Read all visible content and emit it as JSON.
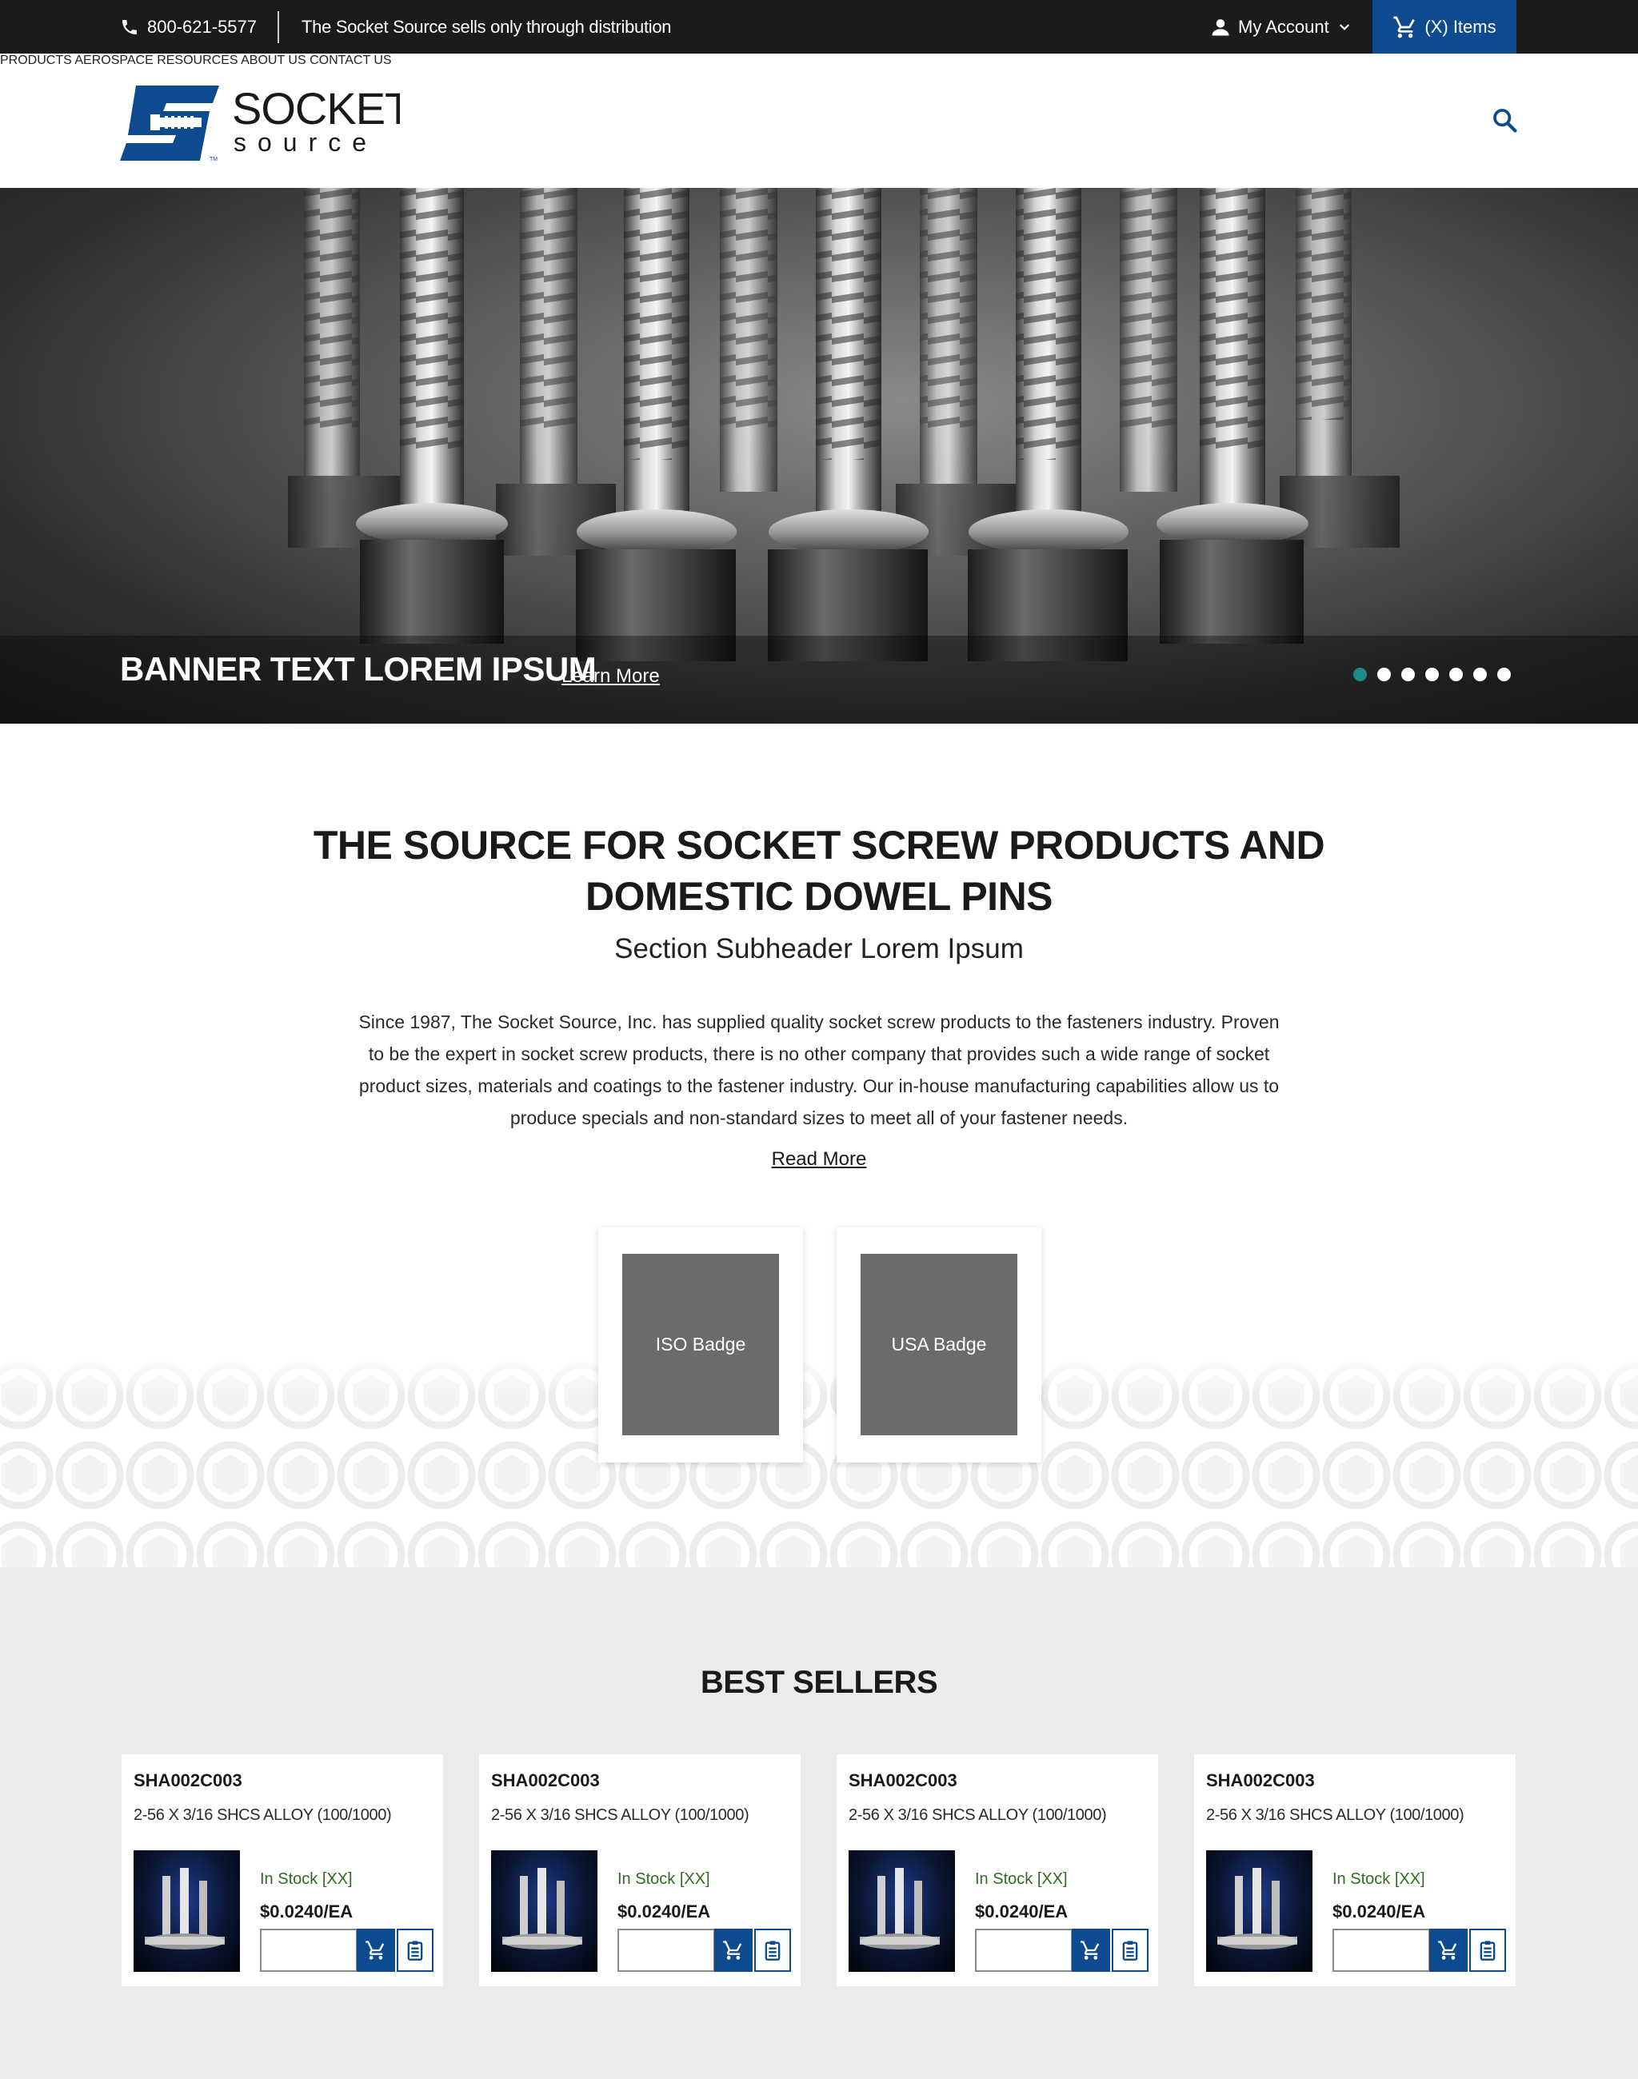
{
  "topbar": {
    "phone": "800-621-5577",
    "notice": "The Socket Source sells only through distribution",
    "account_label": "My Account",
    "cart_label": "(X) Items"
  },
  "header": {
    "logo_text_top": "SOCKET",
    "logo_text_bottom": "source",
    "nav": [
      "PRODUCTS",
      "AEROSPACE",
      "RESOURCES",
      "ABOUT US",
      "CONTACT US"
    ]
  },
  "hero": {
    "banner_text": "BANNER TEXT LOREM IPSUM",
    "link_label": "Learn More",
    "slide_count": 7,
    "active_slide": 1
  },
  "about": {
    "title_line1": "THE SOURCE FOR SOCKET SCREW PRODUCTS AND",
    "title_line2": "DOMESTIC DOWEL PINS",
    "subheader": "Section Subheader Lorem Ipsum",
    "body_lines": [
      "Since 1987, The Socket Source, Inc. has supplied quality socket screw products to the fasteners industry. Proven",
      "to be the expert in socket screw products, there is no other company that provides such a wide range of socket",
      "product sizes, materials and coatings to the fastener industry. Our in-house manufacturing capabilities allow us to",
      "produce specials and non-standard sizes to meet all of your fastener needs."
    ],
    "read_more": "Read More",
    "badges": [
      "ISO Badge",
      "USA Badge"
    ]
  },
  "best_sellers": {
    "title": "BEST SELLERS",
    "products": [
      {
        "sku": "SHA002C003",
        "desc": "2-56 X 3/16 SHCS ALLOY (100/1000)",
        "stock": "In Stock [XX]",
        "price": "$0.0240/EA",
        "qty": ""
      },
      {
        "sku": "SHA002C003",
        "desc": "2-56 X 3/16 SHCS ALLOY (100/1000)",
        "stock": "In Stock [XX]",
        "price": "$0.0240/EA",
        "qty": ""
      },
      {
        "sku": "SHA002C003",
        "desc": "2-56 X 3/16 SHCS ALLOY (100/1000)",
        "stock": "In Stock [XX]",
        "price": "$0.0240/EA",
        "qty": ""
      },
      {
        "sku": "SHA002C003",
        "desc": "2-56 X 3/16 SHCS ALLOY (100/1000)",
        "stock": "In Stock [XX]",
        "price": "$0.0240/EA",
        "qty": ""
      }
    ]
  },
  "colors": {
    "brand_blue": "#0e4a8f",
    "topbar_bg": "#1b1b1b",
    "active_dot": "#1e8c8a",
    "stock_green": "#2f6b21",
    "section_gray": "#ebebeb"
  },
  "icons": [
    "phone-icon",
    "user-icon",
    "chevron-down-icon",
    "cart-icon",
    "search-icon",
    "add-to-cart-icon",
    "add-to-list-icon"
  ]
}
